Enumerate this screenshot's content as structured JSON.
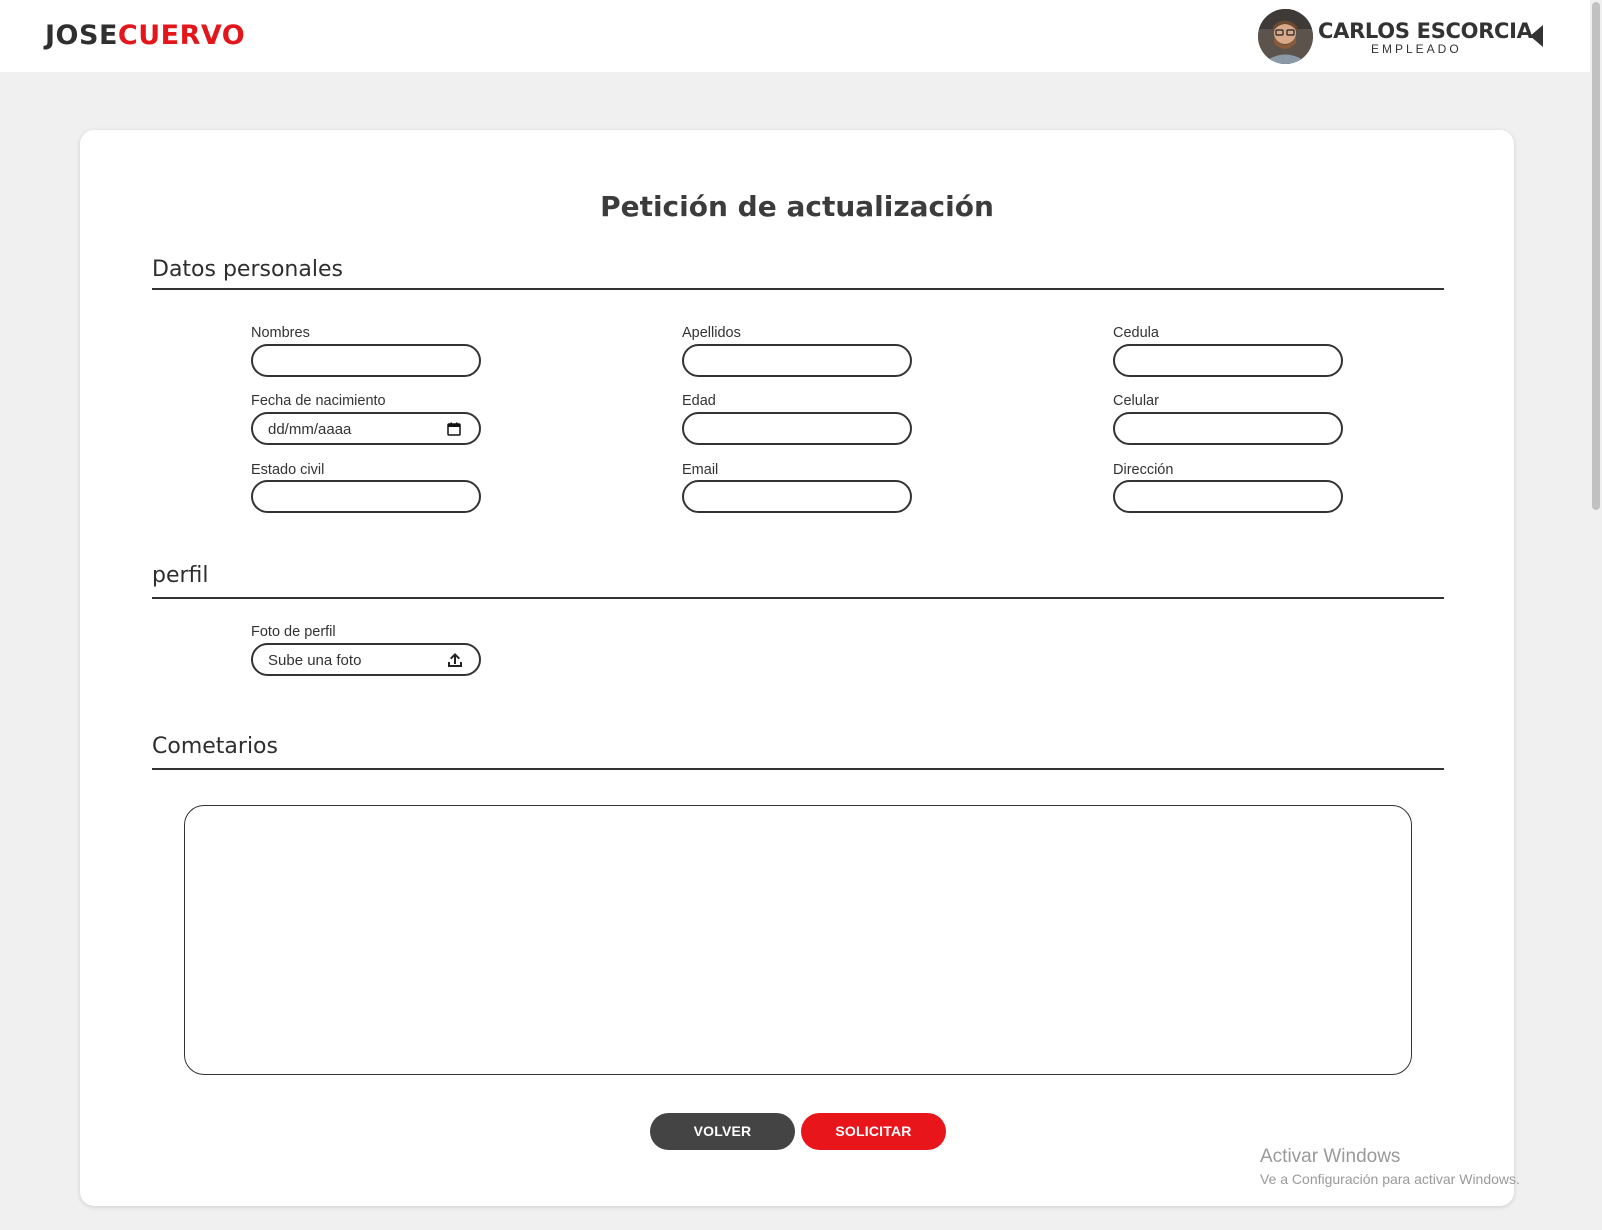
{
  "brand": {
    "part1": "JOSE",
    "part2": "CUERVO",
    "color_dark": "#2f2f2f",
    "color_accent": "#e3161c"
  },
  "user": {
    "name": "CARLOS ESCORCIA",
    "role": "EMPLEADO",
    "menu_icon": "caret-left-icon"
  },
  "page": {
    "title": "Petición de actualización"
  },
  "sections": {
    "personal": "Datos personales",
    "profile": "perfil",
    "comments": "Cometarios"
  },
  "fields": {
    "nombres": {
      "label": "Nombres",
      "value": ""
    },
    "apellidos": {
      "label": "Apellidos",
      "value": ""
    },
    "cedula": {
      "label": "Cedula",
      "value": ""
    },
    "fecha_nacimiento": {
      "label": "Fecha de nacimiento",
      "placeholder": "dd/mm/aaaa",
      "icon": "calendar-icon"
    },
    "edad": {
      "label": "Edad",
      "value": ""
    },
    "celular": {
      "label": "Celular",
      "value": ""
    },
    "estado_civil": {
      "label": "Estado civil",
      "value": ""
    },
    "email": {
      "label": "Email",
      "value": ""
    },
    "direccion": {
      "label": "Dirección",
      "value": ""
    },
    "foto_perfil": {
      "label": "Foto de perfil",
      "placeholder": "Sube una foto",
      "icon": "upload-icon"
    }
  },
  "comments": {
    "value": ""
  },
  "buttons": {
    "back": "VOLVER",
    "submit": "SOLICITAR",
    "back_color": "#444444",
    "submit_color": "#e8151b"
  },
  "watermark": {
    "line1": "Activar Windows",
    "line2": "Ve a Configuración para activar Windows."
  }
}
